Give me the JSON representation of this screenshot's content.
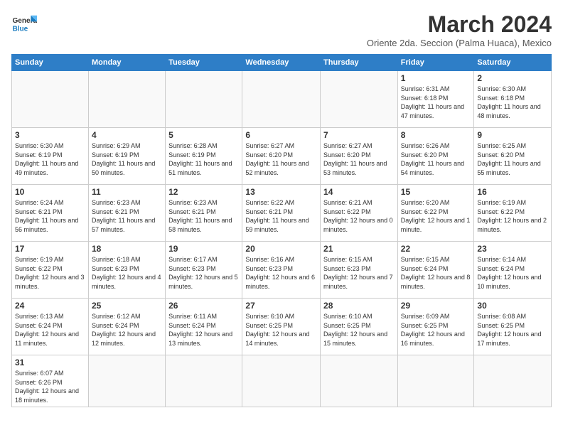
{
  "logo": {
    "line1": "General",
    "line2": "Blue"
  },
  "title": "March 2024",
  "subtitle": "Oriente 2da. Seccion (Palma Huaca), Mexico",
  "days_of_week": [
    "Sunday",
    "Monday",
    "Tuesday",
    "Wednesday",
    "Thursday",
    "Friday",
    "Saturday"
  ],
  "weeks": [
    [
      {
        "day": "",
        "info": ""
      },
      {
        "day": "",
        "info": ""
      },
      {
        "day": "",
        "info": ""
      },
      {
        "day": "",
        "info": ""
      },
      {
        "day": "",
        "info": ""
      },
      {
        "day": "1",
        "info": "Sunrise: 6:31 AM\nSunset: 6:18 PM\nDaylight: 11 hours and 47 minutes."
      },
      {
        "day": "2",
        "info": "Sunrise: 6:30 AM\nSunset: 6:18 PM\nDaylight: 11 hours and 48 minutes."
      }
    ],
    [
      {
        "day": "3",
        "info": "Sunrise: 6:30 AM\nSunset: 6:19 PM\nDaylight: 11 hours and 49 minutes."
      },
      {
        "day": "4",
        "info": "Sunrise: 6:29 AM\nSunset: 6:19 PM\nDaylight: 11 hours and 50 minutes."
      },
      {
        "day": "5",
        "info": "Sunrise: 6:28 AM\nSunset: 6:19 PM\nDaylight: 11 hours and 51 minutes."
      },
      {
        "day": "6",
        "info": "Sunrise: 6:27 AM\nSunset: 6:20 PM\nDaylight: 11 hours and 52 minutes."
      },
      {
        "day": "7",
        "info": "Sunrise: 6:27 AM\nSunset: 6:20 PM\nDaylight: 11 hours and 53 minutes."
      },
      {
        "day": "8",
        "info": "Sunrise: 6:26 AM\nSunset: 6:20 PM\nDaylight: 11 hours and 54 minutes."
      },
      {
        "day": "9",
        "info": "Sunrise: 6:25 AM\nSunset: 6:20 PM\nDaylight: 11 hours and 55 minutes."
      }
    ],
    [
      {
        "day": "10",
        "info": "Sunrise: 6:24 AM\nSunset: 6:21 PM\nDaylight: 11 hours and 56 minutes."
      },
      {
        "day": "11",
        "info": "Sunrise: 6:23 AM\nSunset: 6:21 PM\nDaylight: 11 hours and 57 minutes."
      },
      {
        "day": "12",
        "info": "Sunrise: 6:23 AM\nSunset: 6:21 PM\nDaylight: 11 hours and 58 minutes."
      },
      {
        "day": "13",
        "info": "Sunrise: 6:22 AM\nSunset: 6:21 PM\nDaylight: 11 hours and 59 minutes."
      },
      {
        "day": "14",
        "info": "Sunrise: 6:21 AM\nSunset: 6:22 PM\nDaylight: 12 hours and 0 minutes."
      },
      {
        "day": "15",
        "info": "Sunrise: 6:20 AM\nSunset: 6:22 PM\nDaylight: 12 hours and 1 minute."
      },
      {
        "day": "16",
        "info": "Sunrise: 6:19 AM\nSunset: 6:22 PM\nDaylight: 12 hours and 2 minutes."
      }
    ],
    [
      {
        "day": "17",
        "info": "Sunrise: 6:19 AM\nSunset: 6:22 PM\nDaylight: 12 hours and 3 minutes."
      },
      {
        "day": "18",
        "info": "Sunrise: 6:18 AM\nSunset: 6:23 PM\nDaylight: 12 hours and 4 minutes."
      },
      {
        "day": "19",
        "info": "Sunrise: 6:17 AM\nSunset: 6:23 PM\nDaylight: 12 hours and 5 minutes."
      },
      {
        "day": "20",
        "info": "Sunrise: 6:16 AM\nSunset: 6:23 PM\nDaylight: 12 hours and 6 minutes."
      },
      {
        "day": "21",
        "info": "Sunrise: 6:15 AM\nSunset: 6:23 PM\nDaylight: 12 hours and 7 minutes."
      },
      {
        "day": "22",
        "info": "Sunrise: 6:15 AM\nSunset: 6:24 PM\nDaylight: 12 hours and 8 minutes."
      },
      {
        "day": "23",
        "info": "Sunrise: 6:14 AM\nSunset: 6:24 PM\nDaylight: 12 hours and 10 minutes."
      }
    ],
    [
      {
        "day": "24",
        "info": "Sunrise: 6:13 AM\nSunset: 6:24 PM\nDaylight: 12 hours and 11 minutes."
      },
      {
        "day": "25",
        "info": "Sunrise: 6:12 AM\nSunset: 6:24 PM\nDaylight: 12 hours and 12 minutes."
      },
      {
        "day": "26",
        "info": "Sunrise: 6:11 AM\nSunset: 6:24 PM\nDaylight: 12 hours and 13 minutes."
      },
      {
        "day": "27",
        "info": "Sunrise: 6:10 AM\nSunset: 6:25 PM\nDaylight: 12 hours and 14 minutes."
      },
      {
        "day": "28",
        "info": "Sunrise: 6:10 AM\nSunset: 6:25 PM\nDaylight: 12 hours and 15 minutes."
      },
      {
        "day": "29",
        "info": "Sunrise: 6:09 AM\nSunset: 6:25 PM\nDaylight: 12 hours and 16 minutes."
      },
      {
        "day": "30",
        "info": "Sunrise: 6:08 AM\nSunset: 6:25 PM\nDaylight: 12 hours and 17 minutes."
      }
    ],
    [
      {
        "day": "31",
        "info": "Sunrise: 6:07 AM\nSunset: 6:26 PM\nDaylight: 12 hours and 18 minutes."
      },
      {
        "day": "",
        "info": ""
      },
      {
        "day": "",
        "info": ""
      },
      {
        "day": "",
        "info": ""
      },
      {
        "day": "",
        "info": ""
      },
      {
        "day": "",
        "info": ""
      },
      {
        "day": "",
        "info": ""
      }
    ]
  ]
}
